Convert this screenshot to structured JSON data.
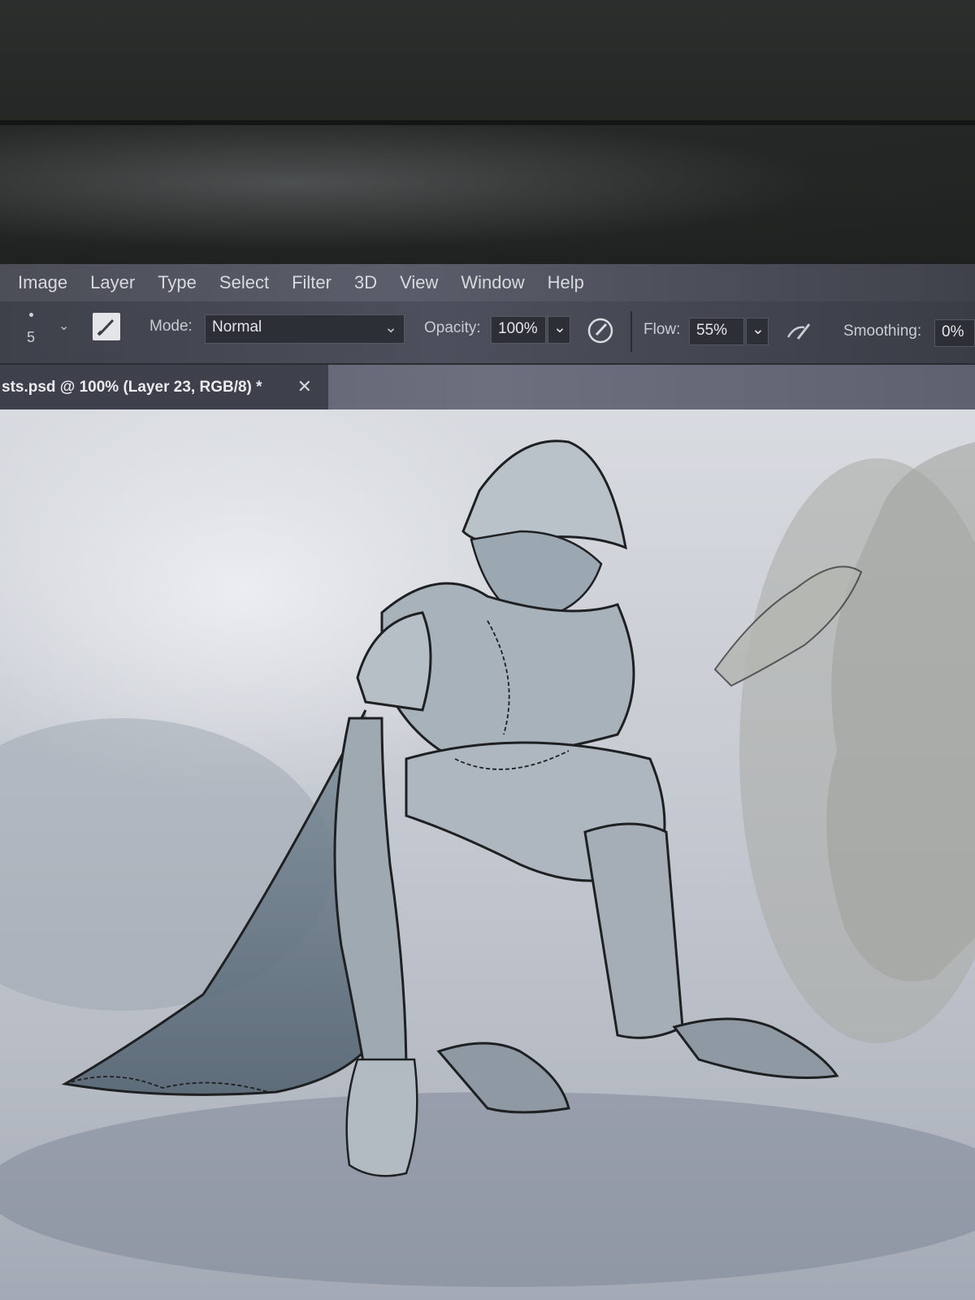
{
  "menu": {
    "items": [
      "Image",
      "Layer",
      "Type",
      "Select",
      "Filter",
      "3D",
      "View",
      "Window",
      "Help"
    ]
  },
  "options": {
    "brush_size": "5",
    "mode_label": "Mode:",
    "mode_value": "Normal",
    "opacity_label": "Opacity:",
    "opacity_value": "100%",
    "flow_label": "Flow:",
    "flow_value": "55%",
    "smoothing_label": "Smoothing:",
    "smoothing_value": "0%"
  },
  "document_tab": {
    "title": "sts.psd @ 100% (Layer 23, RGB/8) *",
    "close_symbol": "✕"
  },
  "colors": {
    "menubar": "#4b4e57",
    "canvas_light": "#d8dbe0",
    "line_art": "#1e2022"
  }
}
